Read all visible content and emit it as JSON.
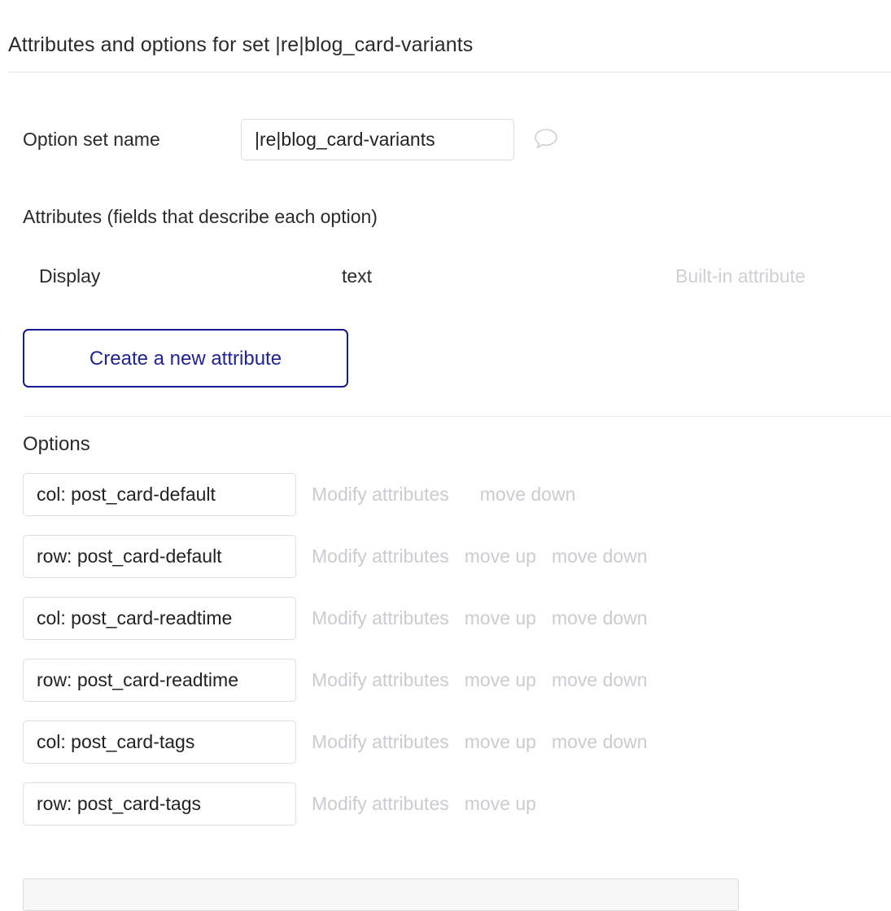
{
  "header": {
    "title": "Attributes and options for set |re|blog_card-variants"
  },
  "option_set": {
    "label": "Option set name",
    "value": "|re|blog_card-variants",
    "placeholder": "",
    "comment_icon": "comment-icon"
  },
  "attributes_section": {
    "heading": "Attributes (fields that describe each option)",
    "rows": [
      {
        "display": "Display",
        "type": "text",
        "note": "Built-in attribute"
      }
    ],
    "create_button": "Create a new attribute"
  },
  "options_section": {
    "heading": "Options",
    "actions": {
      "modify": "Modify attributes",
      "move_up": "move up",
      "move_down": "move down"
    },
    "rows": [
      {
        "value": "col: post_card-default",
        "modify": "Modify attributes",
        "move_up": "",
        "move_down": "move down"
      },
      {
        "value": "row: post_card-default",
        "modify": "Modify attributes",
        "move_up": "move up",
        "move_down": "move down"
      },
      {
        "value": "col: post_card-readtime",
        "modify": "Modify attributes",
        "move_up": "move up",
        "move_down": "move down"
      },
      {
        "value": "row: post_card-readtime",
        "modify": "Modify attributes",
        "move_up": "move up",
        "move_down": "move down"
      },
      {
        "value": "col: post_card-tags",
        "modify": "Modify attributes",
        "move_up": "move up",
        "move_down": "move down"
      },
      {
        "value": "row: post_card-tags",
        "modify": "Modify attributes",
        "move_up": "move up",
        "move_down": ""
      }
    ]
  },
  "colors": {
    "accent": "#1f2395",
    "muted_text": "#cbcbd0",
    "border": "#dcdcde",
    "text": "#2b2b2b"
  }
}
